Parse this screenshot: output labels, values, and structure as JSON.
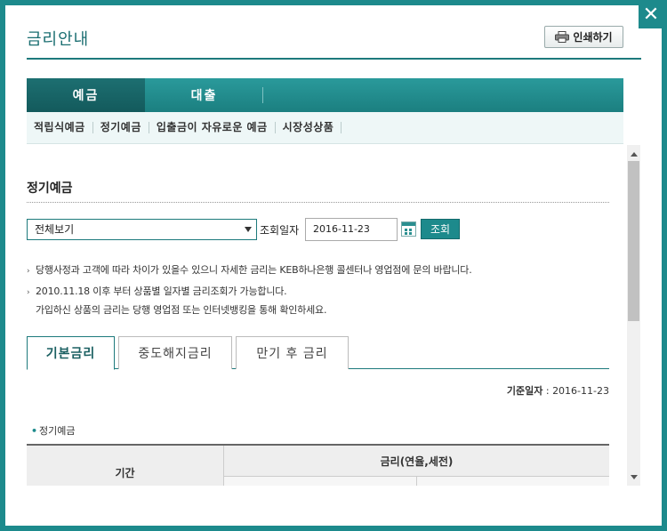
{
  "window": {
    "title": "금리안내",
    "print_label": "인쇄하기",
    "close_glyph": "✕"
  },
  "main_tabs": [
    {
      "label": "예금",
      "active": true
    },
    {
      "label": "대출",
      "active": false
    }
  ],
  "sub_nav": [
    "적립식예금",
    "정기예금",
    "입출금이 자유로운 예금",
    "시장성상품"
  ],
  "section": {
    "title": "정기예금"
  },
  "search": {
    "product_select_value": "전체보기",
    "date_label": "조회일자",
    "date_value": "2016-11-23",
    "button_label": "조회"
  },
  "notices": [
    "당행사정과 고객에 따라 차이가 있을수 있으니 자세한 금리는 KEB하나은행 콜센터나 영업점에 문의 바랍니다.",
    "2010.11.18 이후 부터 상품별 일자별 금리조회가 가능합니다.",
    "가입하신 상품의 금리는 당행 영업점 또는 인터넷뱅킹을 통해 확인하세요."
  ],
  "rate_tabs": [
    {
      "label": "기본금리",
      "active": true
    },
    {
      "label": "중도해지금리",
      "active": false
    },
    {
      "label": "만기 후 금리",
      "active": false
    }
  ],
  "base_date": {
    "label": "기준일자",
    "value": "2016-11-23"
  },
  "table": {
    "caption": "정기예금",
    "headers": {
      "period": "기간",
      "rate": "금리(연율,세전)"
    }
  },
  "colors": {
    "accent": "#1d8a8c",
    "accent_dark": "#135a5c",
    "sub_nav_bg": "#eef7f7"
  }
}
